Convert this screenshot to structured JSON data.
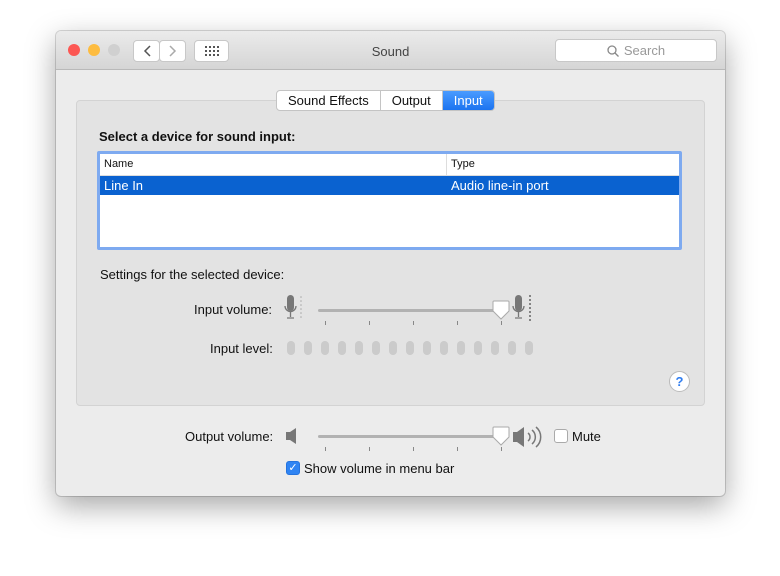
{
  "window": {
    "title": "Sound",
    "search_placeholder": "Search"
  },
  "tabs": [
    {
      "label": "Sound Effects",
      "selected": false
    },
    {
      "label": "Output",
      "selected": false
    },
    {
      "label": "Input",
      "selected": true
    }
  ],
  "input": {
    "device_heading": "Select a device for sound input:",
    "columns": [
      "Name",
      "Type"
    ],
    "devices": [
      {
        "name": "Line In",
        "type": "Audio line-in port",
        "selected": true
      }
    ],
    "settings_heading": "Settings for the selected device:",
    "volume_label": "Input volume:",
    "volume_percent": 100,
    "level_label": "Input level:",
    "level_segments": 15,
    "level_active": 0,
    "help": "?"
  },
  "output": {
    "volume_label": "Output volume:",
    "volume_percent": 100,
    "mute_label": "Mute",
    "mute_checked": false,
    "show_in_menu_bar_label": "Show volume in menu bar",
    "show_in_menu_bar_checked": true
  },
  "colors": {
    "accent": "#1c74f0",
    "selection": "#0a62d0",
    "close": "#fc5753",
    "minimize": "#fdbc40",
    "zoom_disabled": "#d0d0d0"
  }
}
